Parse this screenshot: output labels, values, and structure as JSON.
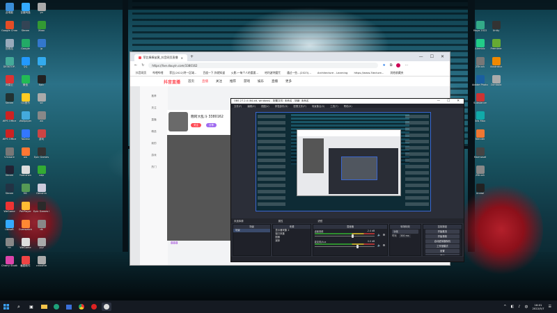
{
  "colors": {
    "accent": "#3b67d1",
    "douyin_red": "#ff4b55",
    "obs_bg": "#2b2e38"
  },
  "desktop_left": [
    {
      "label": "此电脑",
      "c": "#3a8ed8"
    },
    {
      "label": "Google Chrome",
      "c": "#e44d26"
    },
    {
      "label": "回收站",
      "c": "#9ab"
    },
    {
      "label": "DESKTOP-",
      "c": "#4a9"
    },
    {
      "label": "网易云",
      "c": "#d33"
    },
    {
      "label": "Steam",
      "c": "#233"
    },
    {
      "label": "WPS Office",
      "c": "#c22"
    },
    {
      "label": "WPS Office",
      "c": "#c22"
    },
    {
      "label": "Vmware",
      "c": "#777"
    },
    {
      "label": "Steam",
      "c": "#223"
    },
    {
      "label": "Steam",
      "c": "#234"
    },
    {
      "label": "WeGame",
      "c": "#e33"
    },
    {
      "label": "Ubisoft",
      "c": "#3af"
    },
    {
      "label": "hh",
      "c": "#888"
    },
    {
      "label": "Charry Studio",
      "c": "#d4a"
    },
    {
      "label": "百度网盘",
      "c": "#3af"
    },
    {
      "label": "Steam",
      "c": "#345"
    },
    {
      "label": "Google",
      "c": "#2a6"
    },
    {
      "label": "QQ",
      "c": "#29f"
    },
    {
      "label": "微信",
      "c": "#2b5"
    },
    {
      "label": "QQ音乐",
      "c": "#fc2"
    },
    {
      "label": "Wallpaper",
      "c": "#4ad"
    },
    {
      "label": "ToDesk",
      "c": "#37f"
    },
    {
      "label": "ow",
      "c": "#f73"
    },
    {
      "label": "Yuanshen",
      "c": "#ddd"
    },
    {
      "label": "MC",
      "c": "#595"
    },
    {
      "label": "PotPlayer",
      "c": "#fb3"
    },
    {
      "label": "Overwatch",
      "c": "#f83"
    },
    {
      "label": "WeGame",
      "c": "#ddd"
    },
    {
      "label": "截图软件",
      "c": "#e44"
    },
    {
      "label": "yo",
      "c": "#aaa"
    },
    {
      "label": "Xbox",
      "c": "#393"
    },
    {
      "label": "jp",
      "c": "#37c"
    },
    {
      "label": "bi",
      "c": "#3ae"
    },
    {
      "label": "Epic",
      "c": "#222"
    },
    {
      "label": "sd",
      "c": "#aaa"
    },
    {
      "label": "ab",
      "c": "#888"
    },
    {
      "label": "游戏",
      "c": "#c44"
    },
    {
      "label": "Epic Games",
      "c": "#333"
    },
    {
      "label": "cap",
      "c": "#3a3"
    },
    {
      "label": "Genshin",
      "c": "#ccd"
    },
    {
      "label": "Epic Games Launcher",
      "c": "#2a2a2a"
    },
    {
      "label": "dk",
      "c": "#888"
    },
    {
      "label": "yiyi",
      "c": "#aaa"
    },
    {
      "label": "crossfire",
      "c": "#aaa"
    }
  ],
  "desktop_right": [
    {
      "label": "Maya 2022",
      "c": "#3a8"
    },
    {
      "label": "Alembic",
      "c": "#2c8"
    },
    {
      "label": "ZBrush",
      "c": "#777"
    },
    {
      "label": "Adobe Photoshop",
      "c": "#1a5fa0"
    },
    {
      "label": "Substance",
      "c": "#c33"
    },
    {
      "label": "3ds Max",
      "c": "#1aa"
    },
    {
      "label": "Blender",
      "c": "#e73"
    },
    {
      "label": "Marmoset",
      "c": "#444"
    },
    {
      "label": "ZBrush",
      "c": "#888"
    },
    {
      "label": "Unreal",
      "c": "#222"
    },
    {
      "label": "Unity",
      "c": "#333"
    },
    {
      "label": "Premiere",
      "c": "#6a3"
    },
    {
      "label": "Illustrator",
      "c": "#e80"
    },
    {
      "label": "Zomboid",
      "c": "#aaa"
    }
  ],
  "browser": {
    "tab_title": "菲比捧捧苗黄_抖音网页直播 - 抖",
    "url": "https://live.douyin.com/3380162",
    "bookmarks": [
      "抖音网页",
      "哔哩哔哩",
      "菲比(2022)特一区域...",
      "百度一下,你就知道",
      "火影:一每个人的重要...",
      "哈利波特魔咒",
      "通过一些...(2023)...",
      "Architecture - Learning",
      "https://www.3lecture...",
      "其他收藏夹"
    ],
    "site_logo": "抖音直播",
    "nav": [
      "首页",
      "直播",
      "关注",
      "推荐",
      "游戏",
      "娱乐",
      "直播",
      "更多"
    ],
    "rail": [
      "推荐",
      "关注",
      "直播",
      "精选",
      "我的",
      "游戏",
      "热门"
    ],
    "streamer_name": "簡阿大乱斗 3380162",
    "follow_label": "关注",
    "share_label": "分享",
    "badge_text": "888"
  },
  "obs": {
    "title": "OBS 27.2.4 (64-bit, windows) - 配置文件: 未命名 - 场景: 未命名",
    "menu": [
      "文件(F)",
      "编辑(E)",
      "视图(V)",
      "停靠部件(D)",
      "配置文件(P)",
      "场景集合(S)",
      "工具(T)",
      "帮助(H)"
    ],
    "control_bar": [
      "未选择源",
      "属性",
      "滤镜"
    ],
    "docks": {
      "scenes": "场景",
      "sources": "来源",
      "mixer": "混音器",
      "transitions": "转场特效",
      "controls": "控制按钮"
    },
    "scene_item": "场景",
    "sources": [
      "显示器采集 2",
      "窗口采集",
      "图像",
      "媒体"
    ],
    "mixer_items": [
      {
        "name": "桌面音频",
        "db": "-2.4 dB",
        "level": 0.62
      },
      {
        "name": "麦克风/Aux",
        "db": "0.0 dB",
        "level": 0.7
      }
    ],
    "transition_type": "淡化",
    "transition_duration_label": "时长",
    "transition_duration": "300 ms",
    "control_buttons": [
      "开始推流",
      "开始录制",
      "启动虚拟摄像机",
      "工作室模式",
      "设置",
      "退出"
    ]
  },
  "taskbar": {
    "time": "16:01",
    "date": "2022/5/7"
  }
}
